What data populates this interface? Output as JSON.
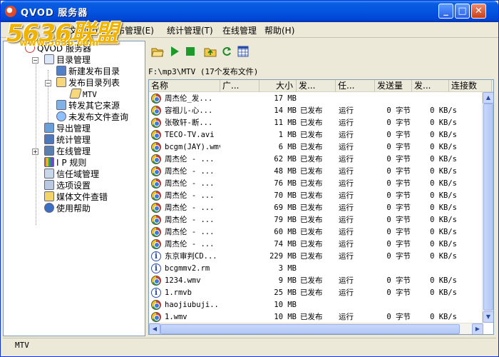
{
  "window": {
    "title": "QVOD 服务器",
    "watermark": "5636联盟",
    "watermark_sub": "www.5636.com"
  },
  "menu": [
    {
      "label": "文件(F)"
    },
    {
      "label": "发布管理(E)"
    },
    {
      "label": "统计管理(T)"
    },
    {
      "label": "在线管理"
    },
    {
      "label": "帮助(H)"
    }
  ],
  "tree": {
    "root": "QVOD 服务器",
    "items": [
      {
        "label": "目录管理",
        "icon": "globe-gear-icon"
      },
      {
        "label": "新建发布目录",
        "icon": "new-folder-icon"
      },
      {
        "label": "发布目录列表",
        "icon": "folder-icon"
      },
      {
        "label": "MTV",
        "icon": "open-folder-icon"
      },
      {
        "label": "转发其它来源",
        "icon": "forward-icon"
      },
      {
        "label": "未发布文件查询",
        "icon": "search-icon"
      },
      {
        "label": "导出管理",
        "icon": "export-icon"
      },
      {
        "label": "统计管理",
        "icon": "stats-icon"
      },
      {
        "label": "在线管理",
        "icon": "online-icon"
      },
      {
        "label": "I P 规则",
        "icon": "ip-rule-icon"
      },
      {
        "label": "信任域管理",
        "icon": "trust-domain-icon"
      },
      {
        "label": "选项设置",
        "icon": "options-icon"
      },
      {
        "label": "媒体文件查错",
        "icon": "media-check-icon"
      },
      {
        "label": "使用帮助",
        "icon": "help-icon"
      }
    ]
  },
  "toolbar": {
    "icons": [
      "open-folder-icon",
      "play-icon",
      "stop-icon",
      "folder-up-icon",
      "refresh-icon",
      "grid-icon"
    ]
  },
  "path": "F:\\mp3\\MTV (17个发布文件)",
  "list": {
    "columns": [
      "名称",
      "广...",
      "大小",
      "发...",
      "任...",
      "发送量",
      "发...",
      "连接数"
    ],
    "rows": [
      {
        "name": "周杰伦_发...",
        "icon": "qvod-icon",
        "size": "17 MB",
        "status": "",
        "task": "",
        "sent": "",
        "speed": ""
      },
      {
        "name": "容祖儿-心...",
        "icon": "qvod-icon",
        "size": "14 MB",
        "status": "已发布",
        "task": "运行",
        "sent": "0 字节",
        "speed": "0 KB/s"
      },
      {
        "name": "张敬轩-断...",
        "icon": "qvod-icon",
        "size": "11 MB",
        "status": "已发布",
        "task": "运行",
        "sent": "0 字节",
        "speed": "0 KB/s"
      },
      {
        "name": "TECO-TV.avi",
        "icon": "qvod-icon",
        "size": "1 MB",
        "status": "已发布",
        "task": "运行",
        "sent": "0 字节",
        "speed": "0 KB/s"
      },
      {
        "name": "bcgm(JAY).wmv",
        "icon": "qvod-icon",
        "size": "6 MB",
        "status": "已发布",
        "task": "运行",
        "sent": "0 字节",
        "speed": "0 KB/s"
      },
      {
        "name": "周杰伦 - ...",
        "icon": "qvod-icon",
        "size": "62 MB",
        "status": "已发布",
        "task": "运行",
        "sent": "0 字节",
        "speed": "0 KB/s"
      },
      {
        "name": "周杰伦 - ...",
        "icon": "qvod-icon",
        "size": "48 MB",
        "status": "已发布",
        "task": "运行",
        "sent": "0 字节",
        "speed": "0 KB/s"
      },
      {
        "name": "周杰伦 - ...",
        "icon": "qvod-icon",
        "size": "76 MB",
        "status": "已发布",
        "task": "运行",
        "sent": "0 字节",
        "speed": "0 KB/s"
      },
      {
        "name": "周杰伦 - ...",
        "icon": "qvod-icon",
        "size": "70 MB",
        "status": "已发布",
        "task": "运行",
        "sent": "0 字节",
        "speed": "0 KB/s"
      },
      {
        "name": "周杰伦 - ...",
        "icon": "qvod-icon",
        "size": "69 MB",
        "status": "已发布",
        "task": "运行",
        "sent": "0 字节",
        "speed": "0 KB/s"
      },
      {
        "name": "周杰伦 - ...",
        "icon": "qvod-icon",
        "size": "79 MB",
        "status": "已发布",
        "task": "运行",
        "sent": "0 字节",
        "speed": "0 KB/s"
      },
      {
        "name": "周杰伦 - ...",
        "icon": "qvod-icon",
        "size": "60 MB",
        "status": "已发布",
        "task": "运行",
        "sent": "0 字节",
        "speed": "0 KB/s"
      },
      {
        "name": "周杰伦 - ...",
        "icon": "qvod-icon",
        "size": "74 MB",
        "status": "已发布",
        "task": "运行",
        "sent": "0 字节",
        "speed": "0 KB/s"
      },
      {
        "name": "东京审判CD...",
        "icon": "info-icon",
        "size": "229 MB",
        "status": "已发布",
        "task": "运行",
        "sent": "0 字节",
        "speed": "0 KB/s"
      },
      {
        "name": "bcgmmv2.rm",
        "icon": "info-icon",
        "size": "3 MB",
        "status": "",
        "task": "",
        "sent": "",
        "speed": ""
      },
      {
        "name": "1234.wmv",
        "icon": "qvod-icon",
        "size": "9 MB",
        "status": "已发布",
        "task": "运行",
        "sent": "0 字节",
        "speed": "0 KB/s"
      },
      {
        "name": "1.rmvb",
        "icon": "info-icon",
        "size": "25 MB",
        "status": "已发布",
        "task": "运行",
        "sent": "0 字节",
        "speed": "0 KB/s"
      },
      {
        "name": "haojiubuji...",
        "icon": "qvod-icon",
        "size": "10 MB",
        "status": "",
        "task": "",
        "sent": "",
        "speed": ""
      },
      {
        "name": "1.wmv",
        "icon": "qvod-icon",
        "size": "10 MB",
        "status": "已发布",
        "task": "运行",
        "sent": "0 字节",
        "speed": "0 KB/s"
      }
    ]
  },
  "status": "MTV"
}
